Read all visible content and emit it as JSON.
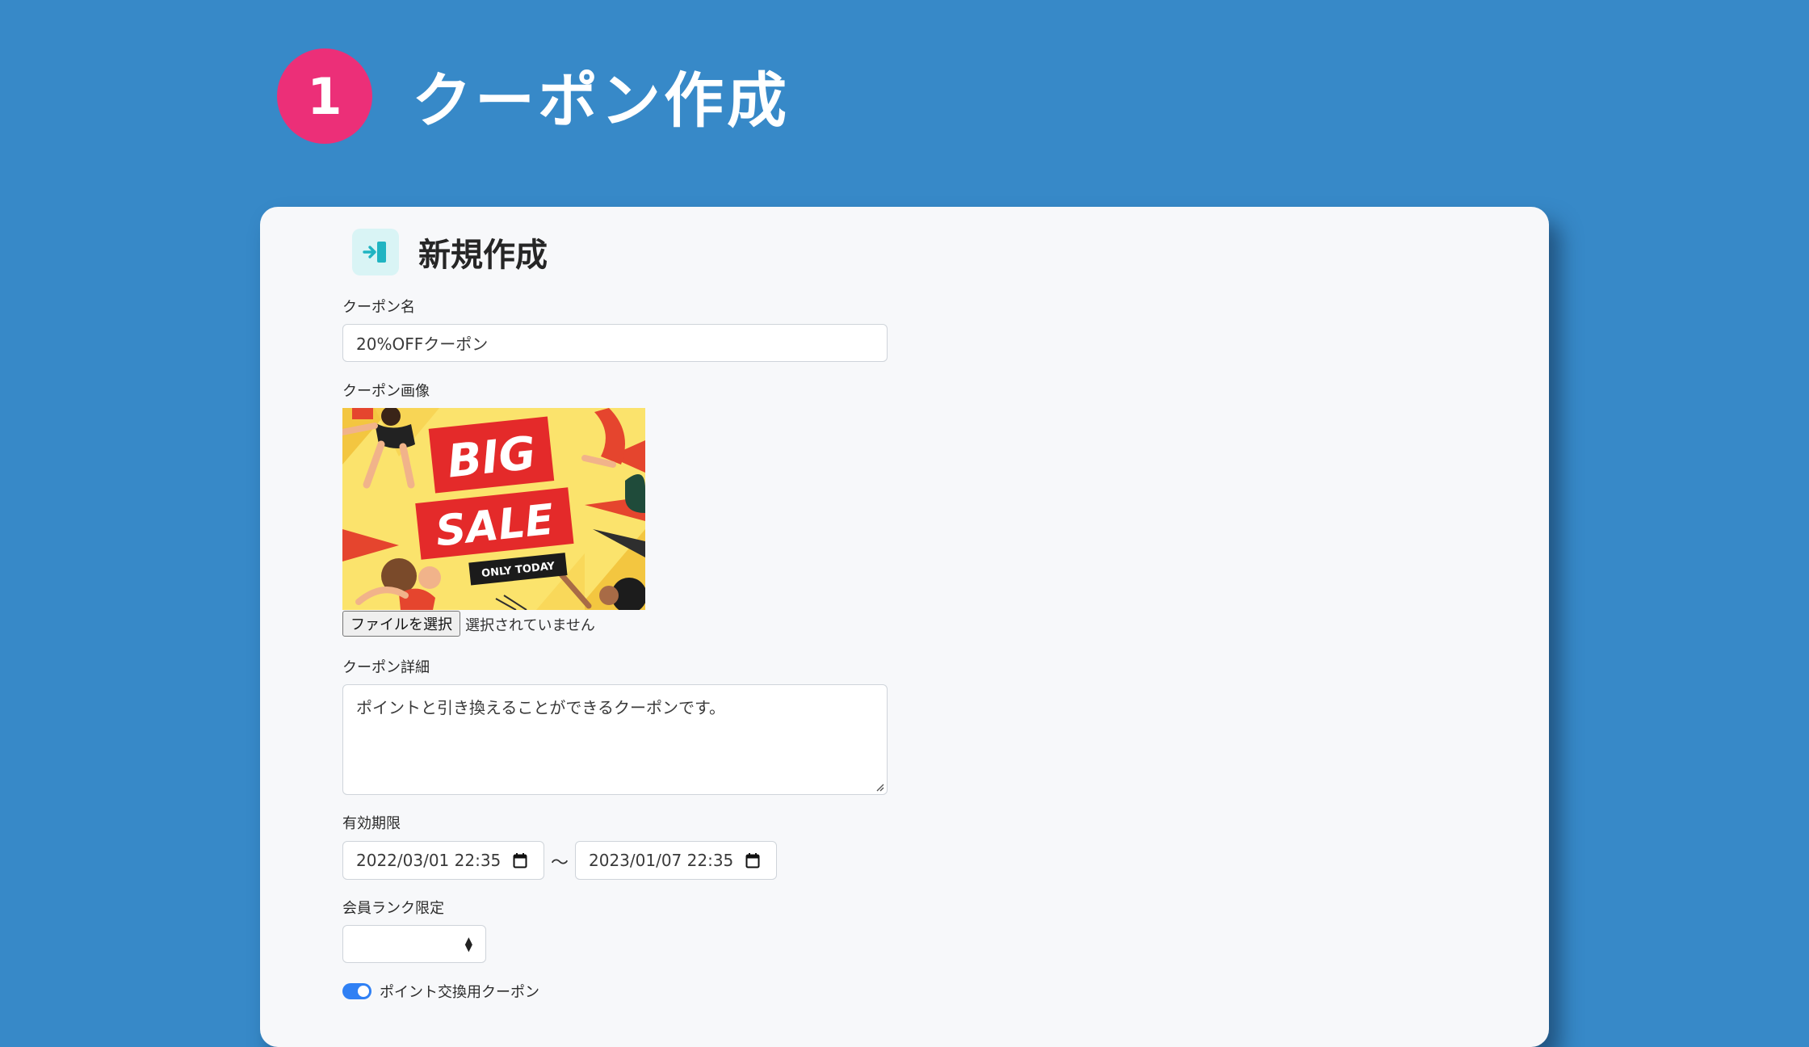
{
  "hero": {
    "step_number": "1",
    "title": "クーポン作成"
  },
  "form": {
    "title": "新規作成",
    "title_icon": "sign-in-arrow-icon",
    "coupon_name": {
      "label": "クーポン名",
      "value": "20%OFFクーポン"
    },
    "coupon_image": {
      "label": "クーポン画像",
      "image_text": {
        "big": "BIG",
        "sale": "SALE",
        "only_today": "ONLY TODAY"
      },
      "file_button": "ファイルを選択",
      "file_status": "選択されていません"
    },
    "coupon_detail": {
      "label": "クーポン詳細",
      "value": "ポイントと引き換えることができるクーポンです。"
    },
    "validity": {
      "label": "有効期限",
      "start": "2022/03/01 22:35",
      "separator": "〜",
      "end": "2023/01/07 22:35"
    },
    "member_rank": {
      "label": "会員ランク限定",
      "selected": ""
    },
    "point_exchange": {
      "label": "ポイント交換用クーポン",
      "checked": true
    }
  },
  "colors": {
    "background": "#3789c8",
    "badge": "#ec2f78",
    "card": "#f7f8fa",
    "toggle": "#2f80f4",
    "sale_red": "#e42a2a",
    "sale_yellow": "#fbe36c"
  }
}
